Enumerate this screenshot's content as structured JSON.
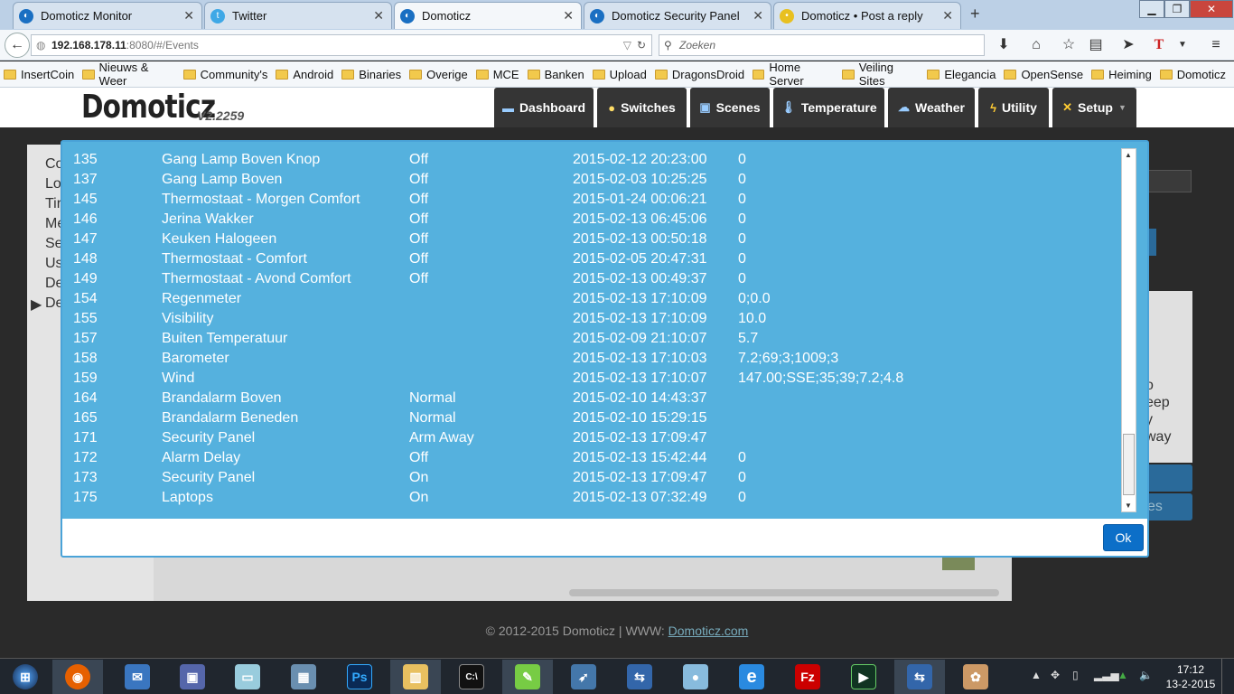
{
  "browser": {
    "tabs": [
      {
        "label": "Domoticz Monitor"
      },
      {
        "label": "Twitter"
      },
      {
        "label": "Domoticz"
      },
      {
        "label": "Domoticz Security Panel"
      },
      {
        "label": "Domoticz • Post a reply"
      }
    ],
    "new_tab": "+",
    "url_host": "192.168.178.11",
    "url_rest": ":8080/#/Events",
    "search_placeholder": "Zoeken",
    "bookmarks": [
      "InsertCoin",
      "Nieuws & Weer",
      "Community's",
      "Android",
      "Binaries",
      "Overige",
      "MCE",
      "Banken",
      "Upload",
      "DragonsDroid",
      "Home Server",
      "Veiling Sites",
      "Elegancia",
      "OpenSense",
      "Heiming",
      "Domoticz"
    ]
  },
  "app": {
    "logo": "Domoticz",
    "version": "V2.2259",
    "menu": [
      {
        "label": "Dashboard",
        "icon": "monitor-icon"
      },
      {
        "label": "Switches",
        "icon": "bulb-icon"
      },
      {
        "label": "Scenes",
        "icon": "scenes-icon"
      },
      {
        "label": "Temperature",
        "icon": "thermometer-icon"
      },
      {
        "label": "Weather",
        "icon": "cloud-icon"
      },
      {
        "label": "Utility",
        "icon": "lightning-icon"
      },
      {
        "label": "Setup",
        "icon": "tools-icon"
      }
    ],
    "footer_text": "© 2012-2015 Domoticz | WWW:",
    "footer_link": "Domoticz.com",
    "bg_left_fragments": [
      "Co",
      "Lo",
      "Tir",
      "Me",
      "Se",
      "Us",
      "De",
      "De"
    ],
    "bg_right_fragments": [
      "o",
      "eep",
      "y",
      "way",
      "es"
    ]
  },
  "dialog": {
    "ok_label": "Ok",
    "rows": [
      {
        "idx": "135",
        "name": "Gang Lamp Boven Knop",
        "status": "Off",
        "date": "2015-02-12 20:23:00",
        "value": "0"
      },
      {
        "idx": "137",
        "name": "Gang Lamp Boven",
        "status": "Off",
        "date": "2015-02-03 10:25:25",
        "value": "0"
      },
      {
        "idx": "145",
        "name": "Thermostaat - Morgen Comfort",
        "status": "Off",
        "date": "2015-01-24 00:06:21",
        "value": "0"
      },
      {
        "idx": "146",
        "name": "Jerina Wakker",
        "status": "Off",
        "date": "2015-02-13 06:45:06",
        "value": "0"
      },
      {
        "idx": "147",
        "name": "Keuken Halogeen",
        "status": "Off",
        "date": "2015-02-13 00:50:18",
        "value": "0"
      },
      {
        "idx": "148",
        "name": "Thermostaat - Comfort",
        "status": "Off",
        "date": "2015-02-05 20:47:31",
        "value": "0"
      },
      {
        "idx": "149",
        "name": "Thermostaat - Avond Comfort",
        "status": "Off",
        "date": "2015-02-13 00:49:37",
        "value": "0"
      },
      {
        "idx": "154",
        "name": "Regenmeter",
        "status": "",
        "date": "2015-02-13 17:10:09",
        "value": "0;0.0"
      },
      {
        "idx": "155",
        "name": "Visibility",
        "status": "",
        "date": "2015-02-13 17:10:09",
        "value": "10.0"
      },
      {
        "idx": "157",
        "name": "Buiten Temperatuur",
        "status": "",
        "date": "2015-02-09 21:10:07",
        "value": "5.7"
      },
      {
        "idx": "158",
        "name": "Barometer",
        "status": "",
        "date": "2015-02-13 17:10:03",
        "value": "7.2;69;3;1009;3"
      },
      {
        "idx": "159",
        "name": "Wind",
        "status": "",
        "date": "2015-02-13 17:10:07",
        "value": "147.00;SSE;35;39;7.2;4.8"
      },
      {
        "idx": "164",
        "name": "Brandalarm Boven",
        "status": "Normal",
        "date": "2015-02-10 14:43:37",
        "value": ""
      },
      {
        "idx": "165",
        "name": "Brandalarm Beneden",
        "status": "Normal",
        "date": "2015-02-10 15:29:15",
        "value": ""
      },
      {
        "idx": "171",
        "name": "Security Panel",
        "status": "Arm Away",
        "date": "2015-02-13 17:09:47",
        "value": ""
      },
      {
        "idx": "172",
        "name": "Alarm Delay",
        "status": "Off",
        "date": "2015-02-13 15:42:44",
        "value": "0"
      },
      {
        "idx": "173",
        "name": "Security Panel",
        "status": "On",
        "date": "2015-02-13 17:09:47",
        "value": "0"
      },
      {
        "idx": "175",
        "name": "Laptops",
        "status": "On",
        "date": "2015-02-13 07:32:49",
        "value": "0"
      }
    ]
  },
  "taskbar": {
    "apps": [
      "start-orb-icon",
      "firefox-icon",
      "thunderbird-icon",
      "disk-utility-icon",
      "notepad-icon",
      "calculator-icon",
      "photoshop-icon",
      "explorer-icon",
      "cmd-icon",
      "notepad-plus-icon",
      "remote-icon",
      "network-icon",
      "lamp-icon",
      "ie-icon",
      "filezilla-icon",
      "console-icon",
      "network2-icon",
      "paint-icon"
    ],
    "ps_label": "Ps",
    "fz_label": "Fz",
    "time": "17:12",
    "date": "13-2-2015"
  },
  "colors": {
    "dialog_bg": "#55b1de",
    "ok_button": "#0c6fc8",
    "menu_bg": "#353535"
  }
}
